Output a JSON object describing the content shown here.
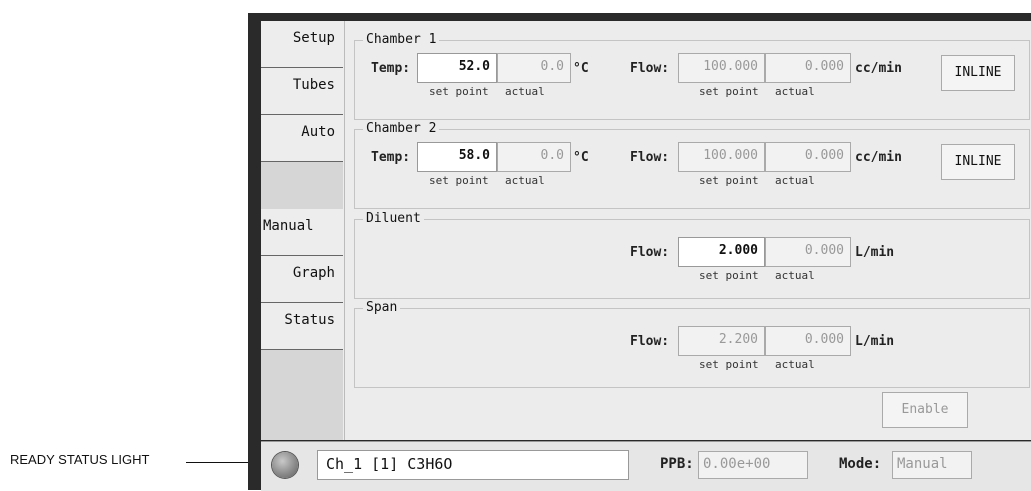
{
  "annotation": {
    "label": "READY STATUS LIGHT"
  },
  "sidebar": {
    "tabs": [
      "Setup",
      "Tubes",
      "Auto",
      "Manual",
      "Graph",
      "Status"
    ],
    "active": "Manual"
  },
  "chamber1": {
    "title": "Chamber 1",
    "temp_label": "Temp:",
    "temp_setpoint": "52.0",
    "temp_actual": "0.0",
    "temp_unit": "°C",
    "flow_label": "Flow:",
    "flow_setpoint": "100.000",
    "flow_actual": "0.000",
    "flow_unit": "cc/min",
    "cap_setpoint": "set point",
    "cap_actual": "actual",
    "button": "INLINE"
  },
  "chamber2": {
    "title": "Chamber 2",
    "temp_label": "Temp:",
    "temp_setpoint": "58.0",
    "temp_actual": "0.0",
    "temp_unit": "°C",
    "flow_label": "Flow:",
    "flow_setpoint": "100.000",
    "flow_actual": "0.000",
    "flow_unit": "cc/min",
    "cap_setpoint": "set point",
    "cap_actual": "actual",
    "button": "INLINE"
  },
  "diluent": {
    "title": "Diluent",
    "flow_label": "Flow:",
    "flow_setpoint": "2.000",
    "flow_actual": "0.000",
    "flow_unit": "L/min",
    "cap_setpoint": "set point",
    "cap_actual": "actual"
  },
  "span": {
    "title": "Span",
    "flow_label": "Flow:",
    "flow_setpoint": "2.200",
    "flow_actual": "0.000",
    "flow_unit": "L/min",
    "cap_setpoint": "set point",
    "cap_actual": "actual"
  },
  "enable_button": "Enable",
  "statusbar": {
    "channel": "Ch_1 [1] C3H6O",
    "ppb_label": "PPB:",
    "ppb_value": "0.00e+00",
    "mode_label": "Mode:",
    "mode_value": "Manual"
  }
}
